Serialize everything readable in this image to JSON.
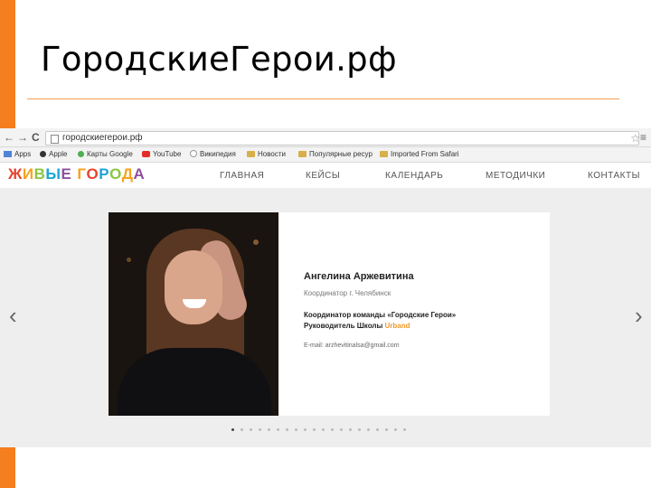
{
  "slide": {
    "title": "ГородскиеГерои.рф",
    "accent_color": "#f57f1f"
  },
  "browser": {
    "back_icon": "←",
    "forward_icon": "→",
    "reload_icon": "C",
    "url": "городскиегерои.рф",
    "star_icon": "☆",
    "menu_icon": "≡",
    "bookmarks": [
      {
        "icon": "grid-icon",
        "label": "Apps"
      },
      {
        "icon": "apple-icon",
        "label": "Apple"
      },
      {
        "icon": "maps-icon",
        "label": "Карты Google"
      },
      {
        "icon": "youtube-icon",
        "label": "YouTube"
      },
      {
        "icon": "wikipedia-icon",
        "label": "Википедия"
      },
      {
        "icon": "folder-icon",
        "label": "Новости"
      },
      {
        "icon": "folder-icon",
        "label": "Популярные ресур"
      },
      {
        "icon": "folder-icon",
        "label": "Imported From Safari"
      }
    ]
  },
  "site": {
    "logo_parts": [
      "Ж",
      "И",
      "В",
      "Ы",
      "Е",
      " ",
      "Г",
      "О",
      "Р",
      "О",
      "Д",
      "А"
    ],
    "logo_colors": [
      "#e8442c",
      "#f7a21b",
      "#8cc63f",
      "#1ba6d6",
      "#8f4f9f",
      "#ffffff",
      "#f7a21b",
      "#e8442c",
      "#1ba6d6",
      "#8cc63f",
      "#f7a21b",
      "#8f4f9f"
    ],
    "nav": [
      "ГЛАВНАЯ",
      "КЕЙСЫ",
      "КАЛЕНДАРЬ",
      "МЕТОДИЧКИ",
      "КОНТАКТЫ"
    ]
  },
  "card": {
    "name": "Ангелина Аржевитина",
    "role": "Координатор г. Челябинск",
    "position_line1": "Координатор команды «Городские Герои»",
    "position_line2_prefix": "Руководитель Школы ",
    "position_line2_highlight": "Urband",
    "email": "E-mail: arzhevitinalsa@gmail.com",
    "highlight_color": "#f39a2a"
  },
  "carousel": {
    "prev_icon": "‹",
    "next_icon": "›",
    "dots_total": 20,
    "active_dot": 1
  }
}
